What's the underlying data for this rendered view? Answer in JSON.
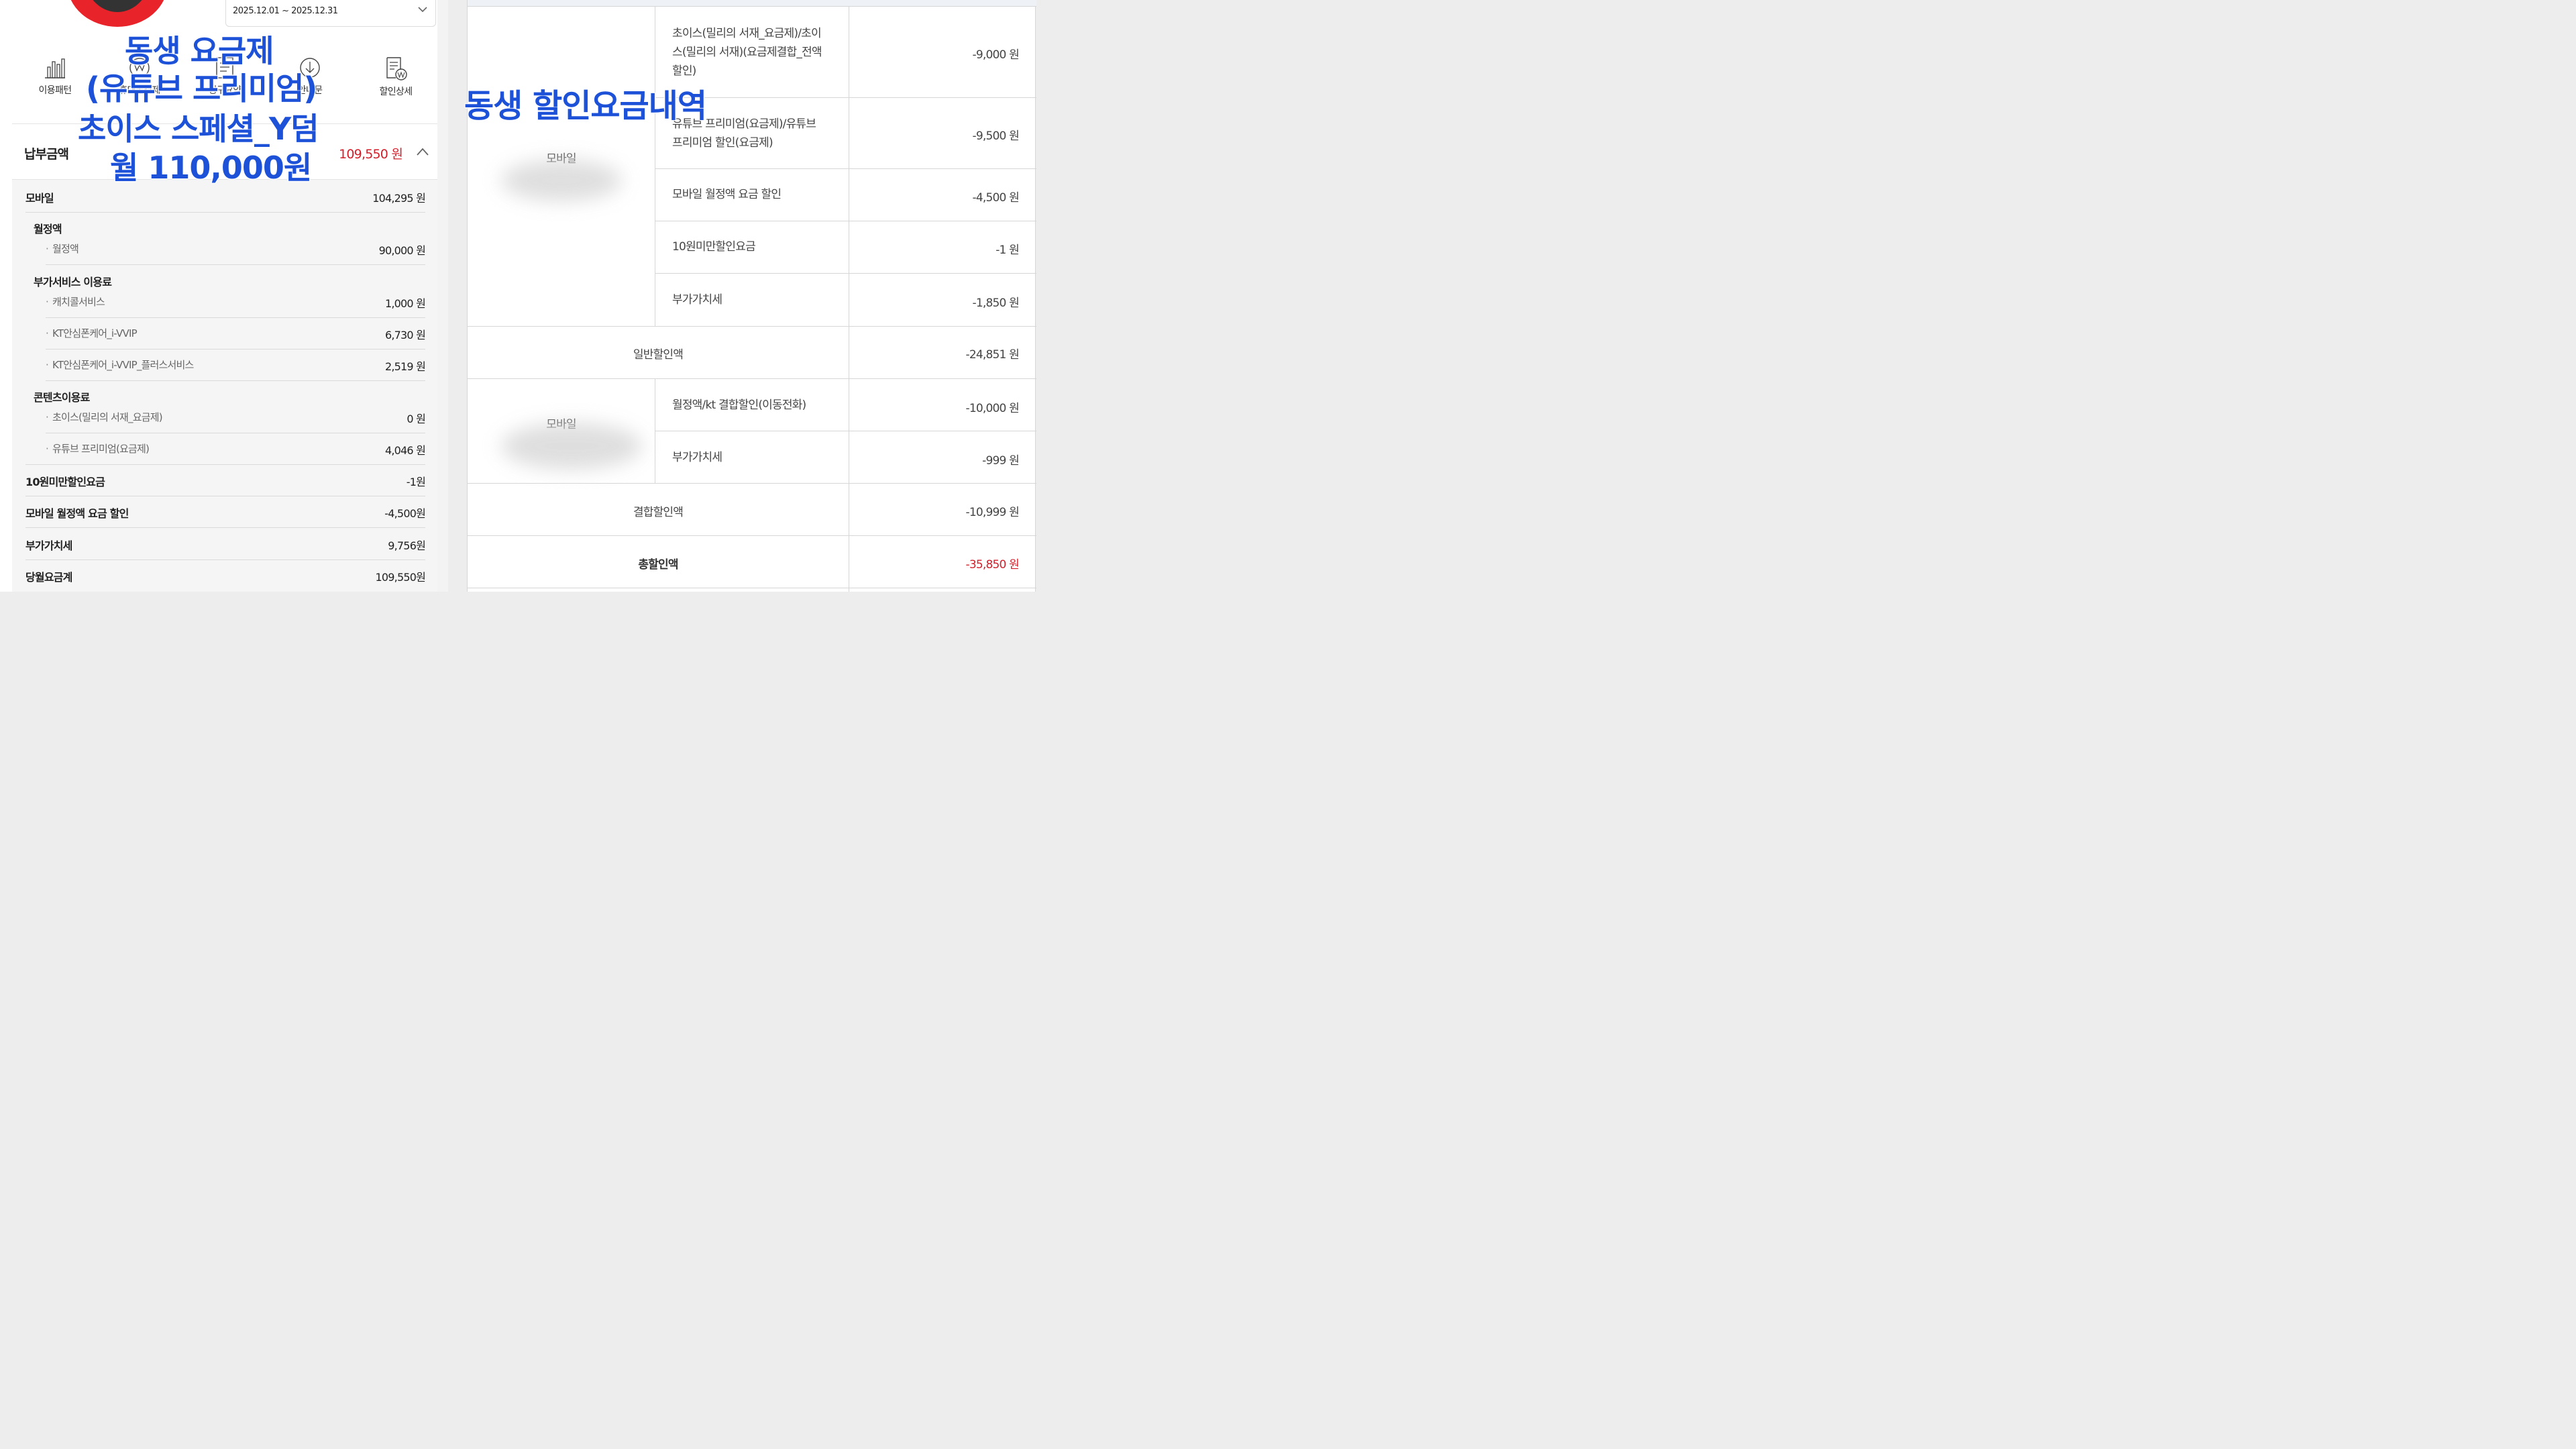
{
  "left": {
    "date_range": "2025.12.01 ~ 2025.12.31",
    "icons": [
      {
        "label": "이용패턴",
        "icon": "bar-chart-icon"
      },
      {
        "label": "휴대폰결제",
        "icon": "coin-icon"
      },
      {
        "label": "청구요약",
        "icon": "document-icon"
      },
      {
        "label": "안내문",
        "icon": "download-icon"
      },
      {
        "label": "할인상세",
        "icon": "receipt-won-icon"
      }
    ],
    "payment": {
      "title": "납부금액",
      "amount": "109,550 원"
    },
    "bill": {
      "mobile": {
        "label": "모바일",
        "amount": "104,295 원"
      },
      "monthly_section": "월정액",
      "monthly_item": {
        "label": "월정액",
        "amount": "90,000 원"
      },
      "addon_section": "부가서비스 이용료",
      "addon_items": [
        {
          "label": "캐치콜서비스",
          "amount": "1,000 원"
        },
        {
          "label": "KT안심폰케어_i-VVIP",
          "amount": "6,730 원"
        },
        {
          "label": "KT안심폰케어_i-VVIP_플러스서비스",
          "amount": "2,519 원"
        }
      ],
      "content_section": "콘텐츠이용료",
      "content_items": [
        {
          "label": "초이스(밀리의 서재_요금제)",
          "amount": "0 원"
        },
        {
          "label": "유튜브 프리미엄(요금제)",
          "amount": "4,046 원"
        }
      ],
      "totals": [
        {
          "label": "10원미만할인요금",
          "amount": "-1원"
        },
        {
          "label": "모바일 월정액 요금 할인",
          "amount": "-4,500원"
        },
        {
          "label": "부가가치세",
          "amount": "9,756원"
        },
        {
          "label": "당월요금계",
          "amount": "109,550원"
        }
      ]
    },
    "overlay": [
      "동생 요금제",
      "(유튜브 프리미엄)",
      "초이스 스페셜_Y덤",
      "월 110,000원"
    ]
  },
  "right": {
    "overlay": "동생 할인요금내역",
    "group1": {
      "category": "모바일",
      "items": [
        {
          "label": "초이스(밀리의 서재_요금제)/초이스(밀리의 서재)(요금제결합_전액할인)",
          "lines": [
            "초이스(밀리의 서재_요금제)/초이",
            "스(밀리의 서재)(요금제결합_전액",
            "할인)"
          ],
          "amount": "-9,000 원"
        },
        {
          "label": "유튜브 프리미엄(요금제)/유튜브 프리미엄 할인(요금제)",
          "lines": [
            "유튜브 프리미엄(요금제)/유튜브",
            "프리미엄 할인(요금제)"
          ],
          "amount": "-9,500 원"
        },
        {
          "label": "모바일 월정액 요금 할인",
          "lines": [
            "모바일 월정액 요금 할인"
          ],
          "amount": "-4,500 원"
        },
        {
          "label": "10원미만할인요금",
          "lines": [
            "10원미만할인요금"
          ],
          "amount": "-1 원"
        },
        {
          "label": "부가가치세",
          "lines": [
            "부가가치세"
          ],
          "amount": "-1,850 원"
        }
      ]
    },
    "general_discount": {
      "label": "일반할인액",
      "amount": "-24,851 원"
    },
    "group2": {
      "category": "모바일",
      "items": [
        {
          "label": "월정액/kt 결합할인(이동전화)",
          "amount": "-10,000 원"
        },
        {
          "label": "부가가치세",
          "amount": "-999 원"
        }
      ]
    },
    "combined_discount": {
      "label": "결합할인액",
      "amount": "-10,999 원"
    },
    "total_discount": {
      "label": "총할인액",
      "amount": "-35,850 원"
    }
  }
}
